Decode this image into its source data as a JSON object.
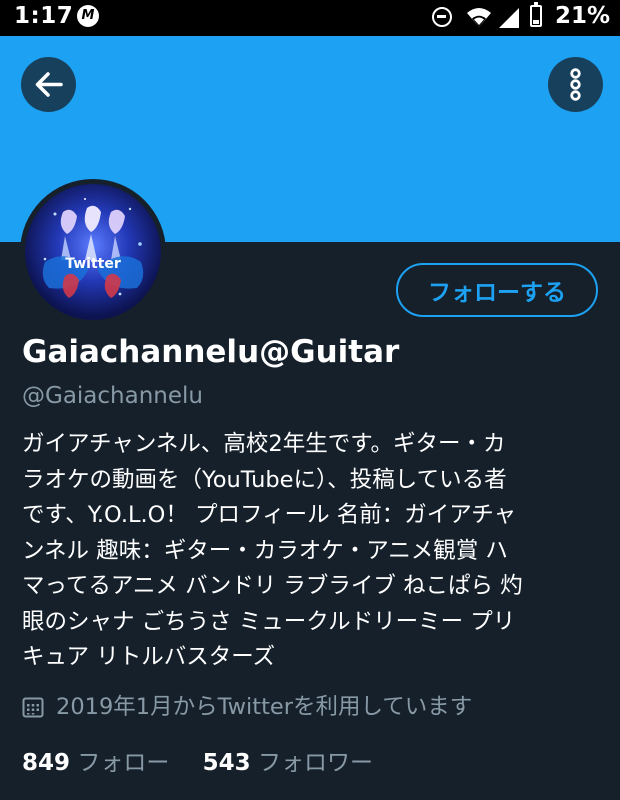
{
  "status_bar": {
    "time": "1:17",
    "app_badge": "M",
    "battery": "21%"
  },
  "header": {
    "banner_color": "#1da1f2",
    "back_icon": "arrow-left-icon",
    "more_icon": "more-vertical-icon"
  },
  "profile": {
    "display_name": "Gaiachannelu@Guitar",
    "handle": "@Gaiachannelu",
    "follow_label": "フォローする",
    "avatar_text": "Twitter",
    "bio_lines": [
      "ガイアチャンネル、高校2年生です。ギター・カ",
      "ラオケの動画を（YouTubeに）、投稿している者",
      "です、Y.O.L.O！ プロフィール 名前：ガイアチャ",
      "ンネル 趣味：ギター・カラオケ・アニメ観賞 ハ",
      "マってるアニメ バンドリ ラブライブ ねこぱら 灼",
      "眼のシャナ ごちうさ ミュークルドリーミー プリ",
      "キュア リトルバスターズ"
    ],
    "joined": "2019年1月からTwitterを利用しています",
    "following_count": "849",
    "following_label": "フォロー",
    "followers_count": "543",
    "followers_label": "フォロワー"
  },
  "colors": {
    "background": "#15202b",
    "accent": "#1da1f2",
    "secondary_text": "#8899a6"
  }
}
